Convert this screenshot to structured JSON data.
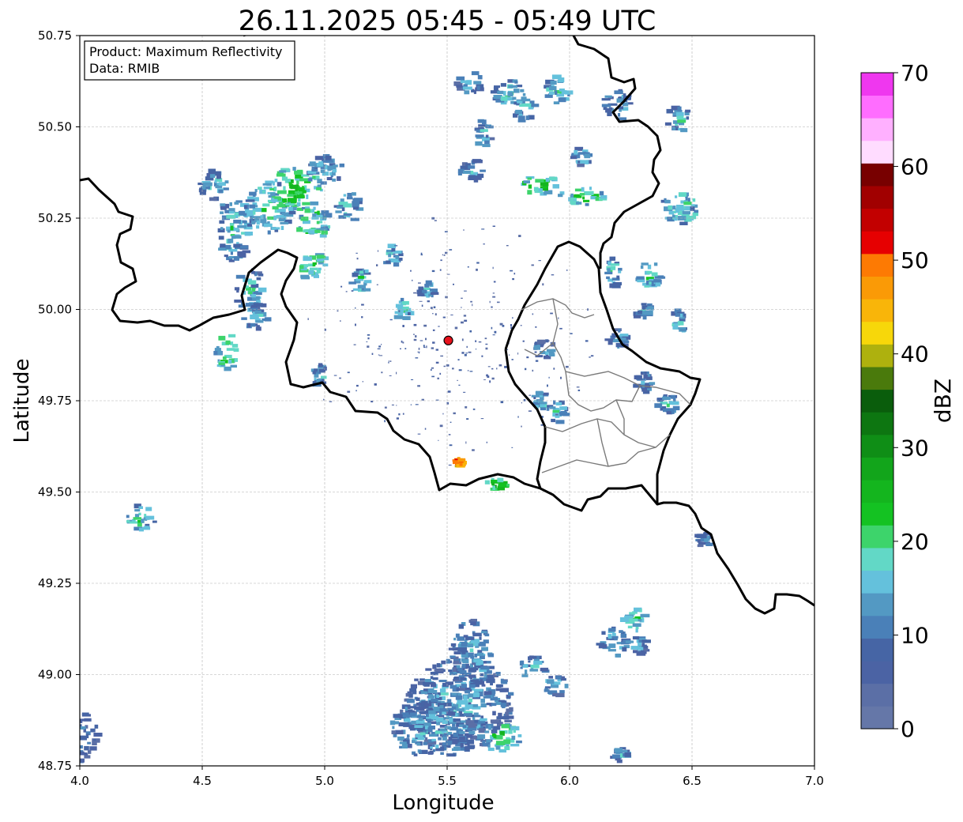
{
  "title": "26.11.2025 05:45 - 05:49 UTC",
  "info_box": {
    "product": "Product: Maximum Reflectivity",
    "source": "Data: RMIB"
  },
  "chart_data": {
    "type": "heatmap",
    "xlabel": "Longitude",
    "ylabel": "Latitude",
    "xlim": [
      4.0,
      7.0
    ],
    "ylim": [
      48.75,
      50.75
    ],
    "x_ticks": [
      "4.0",
      "4.5",
      "5.0",
      "5.5",
      "6.0",
      "6.5",
      "7.0"
    ],
    "y_ticks": [
      "48.75",
      "49.00",
      "49.25",
      "49.50",
      "49.75",
      "50.00",
      "50.25",
      "50.50",
      "50.75"
    ],
    "grid": true,
    "radar_site": {
      "lon": 5.505,
      "lat": 49.915,
      "marker_color": "#e8121c"
    },
    "colorbar": {
      "label": "dBZ",
      "min": 0,
      "max": 70,
      "ticks": [
        "0",
        "10",
        "20",
        "30",
        "40",
        "50",
        "60",
        "70"
      ],
      "colors": [
        "#6577a8",
        "#5b6fa6",
        "#4b63a4",
        "#4665a5",
        "#4a80b8",
        "#5399c3",
        "#64c1dc",
        "#62d8c6",
        "#3dd46b",
        "#14c222",
        "#14b51e",
        "#12a51b",
        "#0f8e16",
        "#0d7611",
        "#0a5d0c",
        "#4a7a0c",
        "#aeb10e",
        "#f7d70a",
        "#f9b509",
        "#fa9a06",
        "#fd7a03",
        "#e60001",
        "#c20000",
        "#a10000",
        "#780000",
        "#ffdcff",
        "#ffb0ff",
        "#ff6dff",
        "#ef37ef"
      ]
    },
    "echoes": [
      {
        "lon": 4.0,
        "lat": 48.83,
        "rx": 0.08,
        "ry": 0.07,
        "dbz": 5
      },
      {
        "lon": 4.25,
        "lat": 49.43,
        "rx": 0.06,
        "ry": 0.035,
        "dbz": 12
      },
      {
        "lon": 4.6,
        "lat": 49.88,
        "rx": 0.04,
        "ry": 0.06,
        "dbz": 14
      },
      {
        "lon": 4.55,
        "lat": 50.34,
        "rx": 0.06,
        "ry": 0.04,
        "dbz": 8
      },
      {
        "lon": 4.63,
        "lat": 50.22,
        "rx": 0.07,
        "ry": 0.09,
        "dbz": 10
      },
      {
        "lon": 4.78,
        "lat": 50.28,
        "rx": 0.09,
        "ry": 0.07,
        "dbz": 12
      },
      {
        "lon": 4.88,
        "lat": 50.33,
        "rx": 0.11,
        "ry": 0.06,
        "dbz": 16
      },
      {
        "lon": 4.95,
        "lat": 50.24,
        "rx": 0.07,
        "ry": 0.05,
        "dbz": 14
      },
      {
        "lon": 5.0,
        "lat": 50.38,
        "rx": 0.08,
        "ry": 0.04,
        "dbz": 8
      },
      {
        "lon": 5.1,
        "lat": 50.28,
        "rx": 0.05,
        "ry": 0.04,
        "dbz": 10
      },
      {
        "lon": 4.7,
        "lat": 50.05,
        "rx": 0.06,
        "ry": 0.06,
        "dbz": 9
      },
      {
        "lon": 4.72,
        "lat": 49.98,
        "rx": 0.05,
        "ry": 0.04,
        "dbz": 8
      },
      {
        "lon": 4.95,
        "lat": 50.12,
        "rx": 0.06,
        "ry": 0.04,
        "dbz": 15
      },
      {
        "lon": 5.15,
        "lat": 50.08,
        "rx": 0.04,
        "ry": 0.03,
        "dbz": 12
      },
      {
        "lon": 5.28,
        "lat": 50.15,
        "rx": 0.04,
        "ry": 0.03,
        "dbz": 10
      },
      {
        "lon": 5.32,
        "lat": 50.0,
        "rx": 0.03,
        "ry": 0.03,
        "dbz": 12
      },
      {
        "lon": 5.42,
        "lat": 50.05,
        "rx": 0.03,
        "ry": 0.025,
        "dbz": 10
      },
      {
        "lon": 4.98,
        "lat": 49.82,
        "rx": 0.04,
        "ry": 0.03,
        "dbz": 8
      },
      {
        "lon": 5.6,
        "lat": 50.62,
        "rx": 0.06,
        "ry": 0.03,
        "dbz": 8
      },
      {
        "lon": 5.75,
        "lat": 50.59,
        "rx": 0.06,
        "ry": 0.04,
        "dbz": 10
      },
      {
        "lon": 5.65,
        "lat": 50.48,
        "rx": 0.04,
        "ry": 0.04,
        "dbz": 8
      },
      {
        "lon": 5.82,
        "lat": 50.55,
        "rx": 0.05,
        "ry": 0.04,
        "dbz": 9
      },
      {
        "lon": 5.95,
        "lat": 50.6,
        "rx": 0.05,
        "ry": 0.04,
        "dbz": 10
      },
      {
        "lon": 5.6,
        "lat": 50.38,
        "rx": 0.05,
        "ry": 0.03,
        "dbz": 8
      },
      {
        "lon": 5.88,
        "lat": 50.34,
        "rx": 0.08,
        "ry": 0.025,
        "dbz": 16
      },
      {
        "lon": 6.05,
        "lat": 50.31,
        "rx": 0.09,
        "ry": 0.025,
        "dbz": 14
      },
      {
        "lon": 6.2,
        "lat": 50.56,
        "rx": 0.06,
        "ry": 0.04,
        "dbz": 8
      },
      {
        "lon": 6.05,
        "lat": 50.42,
        "rx": 0.04,
        "ry": 0.03,
        "dbz": 8
      },
      {
        "lon": 6.45,
        "lat": 50.52,
        "rx": 0.05,
        "ry": 0.04,
        "dbz": 9
      },
      {
        "lon": 6.45,
        "lat": 50.28,
        "rx": 0.07,
        "ry": 0.05,
        "dbz": 12
      },
      {
        "lon": 6.33,
        "lat": 50.1,
        "rx": 0.05,
        "ry": 0.04,
        "dbz": 14
      },
      {
        "lon": 6.3,
        "lat": 50.0,
        "rx": 0.04,
        "ry": 0.025,
        "dbz": 8
      },
      {
        "lon": 6.45,
        "lat": 49.96,
        "rx": 0.03,
        "ry": 0.04,
        "dbz": 10
      },
      {
        "lon": 6.2,
        "lat": 49.92,
        "rx": 0.04,
        "ry": 0.025,
        "dbz": 8
      },
      {
        "lon": 5.9,
        "lat": 49.89,
        "rx": 0.04,
        "ry": 0.025,
        "dbz": 8
      },
      {
        "lon": 5.95,
        "lat": 49.72,
        "rx": 0.04,
        "ry": 0.03,
        "dbz": 10
      },
      {
        "lon": 5.88,
        "lat": 49.75,
        "rx": 0.03,
        "ry": 0.025,
        "dbz": 10
      },
      {
        "lon": 6.3,
        "lat": 49.8,
        "rx": 0.04,
        "ry": 0.03,
        "dbz": 8
      },
      {
        "lon": 6.4,
        "lat": 49.74,
        "rx": 0.04,
        "ry": 0.03,
        "dbz": 9
      },
      {
        "lon": 5.55,
        "lat": 48.92,
        "rx": 0.22,
        "ry": 0.13,
        "dbz": 7
      },
      {
        "lon": 5.45,
        "lat": 48.85,
        "rx": 0.18,
        "ry": 0.08,
        "dbz": 8
      },
      {
        "lon": 5.6,
        "lat": 49.05,
        "rx": 0.08,
        "ry": 0.1,
        "dbz": 8
      },
      {
        "lon": 5.72,
        "lat": 48.83,
        "rx": 0.08,
        "ry": 0.04,
        "dbz": 14
      },
      {
        "lon": 5.85,
        "lat": 49.02,
        "rx": 0.06,
        "ry": 0.03,
        "dbz": 8
      },
      {
        "lon": 5.95,
        "lat": 48.97,
        "rx": 0.05,
        "ry": 0.03,
        "dbz": 8
      },
      {
        "lon": 6.18,
        "lat": 49.09,
        "rx": 0.06,
        "ry": 0.04,
        "dbz": 9
      },
      {
        "lon": 6.27,
        "lat": 49.15,
        "rx": 0.05,
        "ry": 0.03,
        "dbz": 12
      },
      {
        "lon": 6.28,
        "lat": 49.08,
        "rx": 0.04,
        "ry": 0.025,
        "dbz": 8
      },
      {
        "lon": 6.22,
        "lat": 48.78,
        "rx": 0.04,
        "ry": 0.02,
        "dbz": 8
      },
      {
        "lon": 6.55,
        "lat": 49.37,
        "rx": 0.03,
        "ry": 0.02,
        "dbz": 7
      },
      {
        "lon": 5.55,
        "lat": 49.58,
        "rx": 0.02,
        "ry": 0.01,
        "dbz": 44
      },
      {
        "lon": 5.7,
        "lat": 49.52,
        "rx": 0.04,
        "ry": 0.015,
        "dbz": 20
      },
      {
        "lon": 6.18,
        "lat": 50.1,
        "rx": 0.03,
        "ry": 0.04,
        "dbz": 10
      }
    ]
  }
}
